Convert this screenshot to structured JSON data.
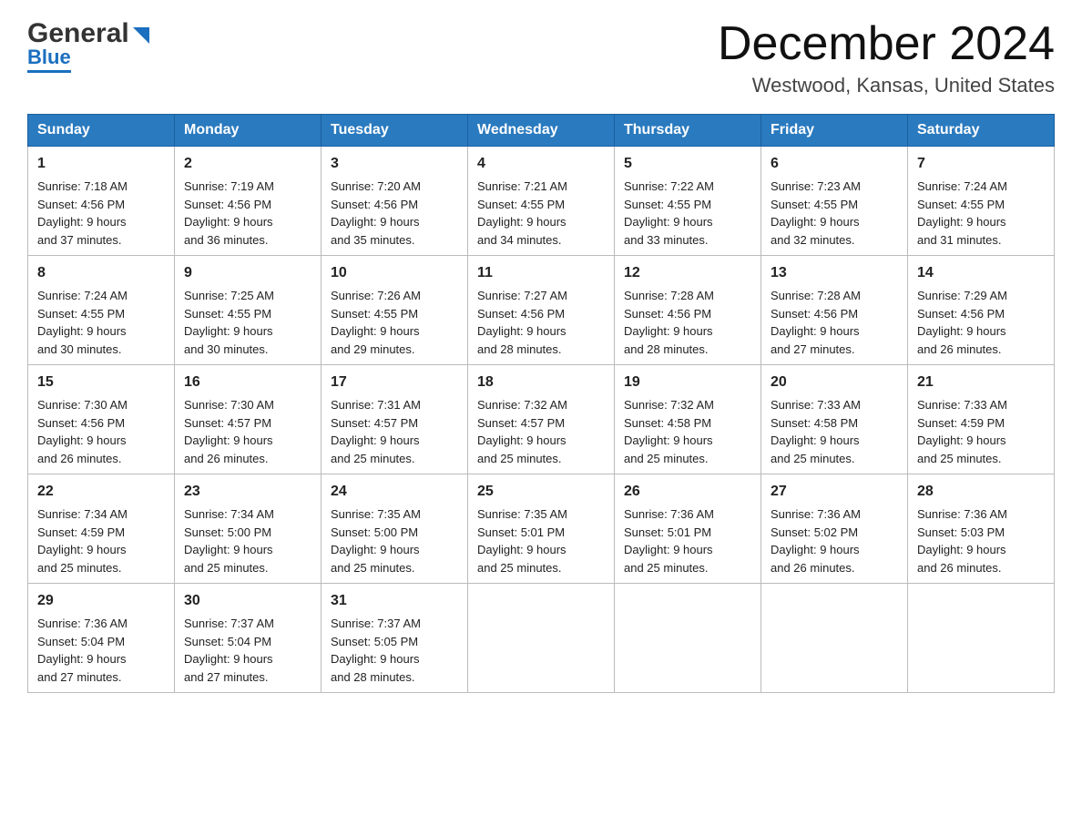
{
  "header": {
    "logo_general": "General",
    "logo_blue": "Blue",
    "month_title": "December 2024",
    "location": "Westwood, Kansas, United States"
  },
  "weekdays": [
    "Sunday",
    "Monday",
    "Tuesday",
    "Wednesday",
    "Thursday",
    "Friday",
    "Saturday"
  ],
  "weeks": [
    [
      {
        "day": "1",
        "sunrise": "7:18 AM",
        "sunset": "4:56 PM",
        "daylight": "9 hours and 37 minutes."
      },
      {
        "day": "2",
        "sunrise": "7:19 AM",
        "sunset": "4:56 PM",
        "daylight": "9 hours and 36 minutes."
      },
      {
        "day": "3",
        "sunrise": "7:20 AM",
        "sunset": "4:56 PM",
        "daylight": "9 hours and 35 minutes."
      },
      {
        "day": "4",
        "sunrise": "7:21 AM",
        "sunset": "4:55 PM",
        "daylight": "9 hours and 34 minutes."
      },
      {
        "day": "5",
        "sunrise": "7:22 AM",
        "sunset": "4:55 PM",
        "daylight": "9 hours and 33 minutes."
      },
      {
        "day": "6",
        "sunrise": "7:23 AM",
        "sunset": "4:55 PM",
        "daylight": "9 hours and 32 minutes."
      },
      {
        "day": "7",
        "sunrise": "7:24 AM",
        "sunset": "4:55 PM",
        "daylight": "9 hours and 31 minutes."
      }
    ],
    [
      {
        "day": "8",
        "sunrise": "7:24 AM",
        "sunset": "4:55 PM",
        "daylight": "9 hours and 30 minutes."
      },
      {
        "day": "9",
        "sunrise": "7:25 AM",
        "sunset": "4:55 PM",
        "daylight": "9 hours and 30 minutes."
      },
      {
        "day": "10",
        "sunrise": "7:26 AM",
        "sunset": "4:55 PM",
        "daylight": "9 hours and 29 minutes."
      },
      {
        "day": "11",
        "sunrise": "7:27 AM",
        "sunset": "4:56 PM",
        "daylight": "9 hours and 28 minutes."
      },
      {
        "day": "12",
        "sunrise": "7:28 AM",
        "sunset": "4:56 PM",
        "daylight": "9 hours and 28 minutes."
      },
      {
        "day": "13",
        "sunrise": "7:28 AM",
        "sunset": "4:56 PM",
        "daylight": "9 hours and 27 minutes."
      },
      {
        "day": "14",
        "sunrise": "7:29 AM",
        "sunset": "4:56 PM",
        "daylight": "9 hours and 26 minutes."
      }
    ],
    [
      {
        "day": "15",
        "sunrise": "7:30 AM",
        "sunset": "4:56 PM",
        "daylight": "9 hours and 26 minutes."
      },
      {
        "day": "16",
        "sunrise": "7:30 AM",
        "sunset": "4:57 PM",
        "daylight": "9 hours and 26 minutes."
      },
      {
        "day": "17",
        "sunrise": "7:31 AM",
        "sunset": "4:57 PM",
        "daylight": "9 hours and 25 minutes."
      },
      {
        "day": "18",
        "sunrise": "7:32 AM",
        "sunset": "4:57 PM",
        "daylight": "9 hours and 25 minutes."
      },
      {
        "day": "19",
        "sunrise": "7:32 AM",
        "sunset": "4:58 PM",
        "daylight": "9 hours and 25 minutes."
      },
      {
        "day": "20",
        "sunrise": "7:33 AM",
        "sunset": "4:58 PM",
        "daylight": "9 hours and 25 minutes."
      },
      {
        "day": "21",
        "sunrise": "7:33 AM",
        "sunset": "4:59 PM",
        "daylight": "9 hours and 25 minutes."
      }
    ],
    [
      {
        "day": "22",
        "sunrise": "7:34 AM",
        "sunset": "4:59 PM",
        "daylight": "9 hours and 25 minutes."
      },
      {
        "day": "23",
        "sunrise": "7:34 AM",
        "sunset": "5:00 PM",
        "daylight": "9 hours and 25 minutes."
      },
      {
        "day": "24",
        "sunrise": "7:35 AM",
        "sunset": "5:00 PM",
        "daylight": "9 hours and 25 minutes."
      },
      {
        "day": "25",
        "sunrise": "7:35 AM",
        "sunset": "5:01 PM",
        "daylight": "9 hours and 25 minutes."
      },
      {
        "day": "26",
        "sunrise": "7:36 AM",
        "sunset": "5:01 PM",
        "daylight": "9 hours and 25 minutes."
      },
      {
        "day": "27",
        "sunrise": "7:36 AM",
        "sunset": "5:02 PM",
        "daylight": "9 hours and 26 minutes."
      },
      {
        "day": "28",
        "sunrise": "7:36 AM",
        "sunset": "5:03 PM",
        "daylight": "9 hours and 26 minutes."
      }
    ],
    [
      {
        "day": "29",
        "sunrise": "7:36 AM",
        "sunset": "5:04 PM",
        "daylight": "9 hours and 27 minutes."
      },
      {
        "day": "30",
        "sunrise": "7:37 AM",
        "sunset": "5:04 PM",
        "daylight": "9 hours and 27 minutes."
      },
      {
        "day": "31",
        "sunrise": "7:37 AM",
        "sunset": "5:05 PM",
        "daylight": "9 hours and 28 minutes."
      },
      null,
      null,
      null,
      null
    ]
  ],
  "labels": {
    "sunrise": "Sunrise:",
    "sunset": "Sunset:",
    "daylight": "Daylight:"
  }
}
